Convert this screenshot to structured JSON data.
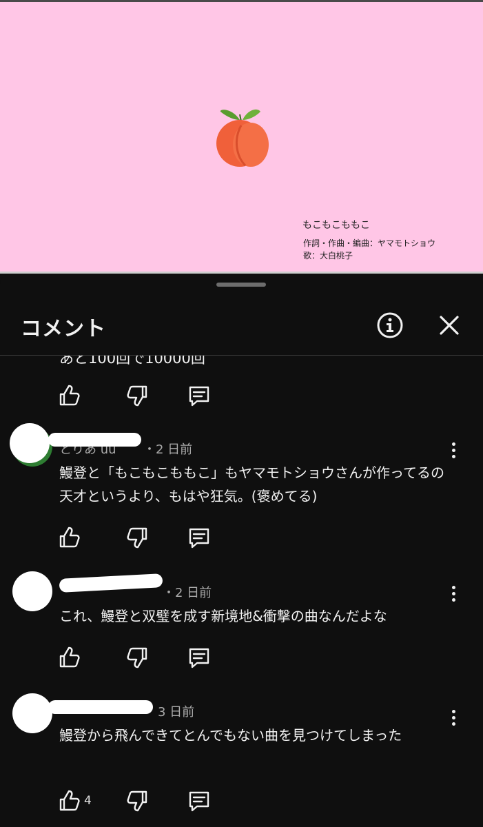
{
  "video": {
    "song_title": "もこもこももこ",
    "credit_line1": "作詞・作曲・編曲：ヤマモトショウ",
    "credit_line2": "歌：大白桃子",
    "background_color": "#ffc6e6",
    "artwork_icon": "peach-icon"
  },
  "sheet": {
    "title": "コメント",
    "info_icon": "info-icon",
    "close_icon": "close-icon"
  },
  "partial_comment": {
    "text_fragment": "あと100回で10000回"
  },
  "comments": [
    {
      "author_visible": "とりあ uu",
      "time": "・2 日前",
      "text": "鰻登と「もこもこももこ」もヤマモトショウさんが作ってるの天才というより、もはや狂気。(褒めてる)",
      "likes": ""
    },
    {
      "author_visible": "",
      "time": "・2 日前",
      "text": "これ、鰻登と双璧を成す新境地&衝撃の曲なんだよな",
      "likes": ""
    },
    {
      "author_visible": "",
      "time": "3 日前",
      "text": "鰻登から飛んできてとんでもない曲を見つけてしまった",
      "likes": "4"
    }
  ]
}
